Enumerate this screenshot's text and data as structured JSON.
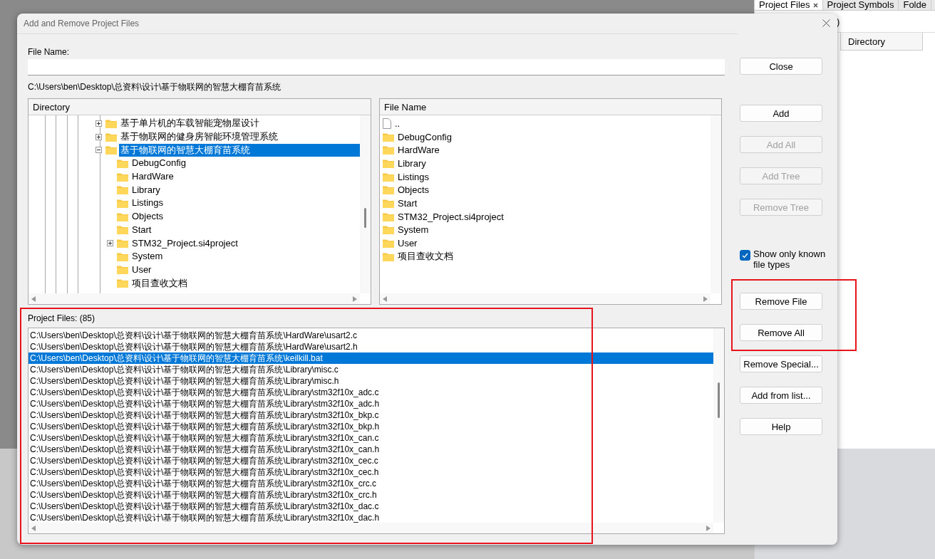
{
  "desktop": {
    "app_tabs": [
      {
        "label": "Project Files",
        "selected": true,
        "closable": true
      },
      {
        "label": "Project Symbols",
        "selected": false,
        "closable": false
      },
      {
        "label": "Folde",
        "selected": false,
        "closable": false
      }
    ],
    "app_filter_text": ")",
    "app_column": "Directory"
  },
  "dialog": {
    "title": "Add and Remove Project Files",
    "file_name_label": "File Name:",
    "current_path": "C:\\Users\\ben\\Desktop\\总资料\\设计\\基于物联网的智慧大棚育苗系统",
    "directory": {
      "header": "Directory",
      "items": [
        {
          "name": "基于单片机的车载智能宠物屋设计",
          "expanded": false,
          "selected": false
        },
        {
          "name": "基于物联网的健身房智能环境管理系统",
          "expanded": false,
          "selected": false
        },
        {
          "name": "基于物联网的智慧大棚育苗系统",
          "expanded": true,
          "selected": true,
          "children": [
            {
              "name": "DebugConfig",
              "selected": false
            },
            {
              "name": "HardWare",
              "selected": false
            },
            {
              "name": "Library",
              "selected": false
            },
            {
              "name": "Listings",
              "selected": false
            },
            {
              "name": "Objects",
              "selected": false
            },
            {
              "name": "Start",
              "selected": false
            },
            {
              "name": "STM32_Project.si4project",
              "expanded": false,
              "selected": false
            },
            {
              "name": "System",
              "selected": false
            },
            {
              "name": "User",
              "selected": false
            },
            {
              "name": "项目查收文档",
              "selected": false
            }
          ]
        }
      ]
    },
    "file_list": {
      "header": "File Name",
      "items": [
        {
          "name": "..",
          "kind": "parent"
        },
        {
          "name": "DebugConfig",
          "kind": "folder"
        },
        {
          "name": "HardWare",
          "kind": "folder"
        },
        {
          "name": "Library",
          "kind": "folder"
        },
        {
          "name": "Listings",
          "kind": "folder"
        },
        {
          "name": "Objects",
          "kind": "folder"
        },
        {
          "name": "Start",
          "kind": "folder"
        },
        {
          "name": "STM32_Project.si4project",
          "kind": "folder"
        },
        {
          "name": "System",
          "kind": "folder"
        },
        {
          "name": "User",
          "kind": "folder"
        },
        {
          "name": "项目查收文档",
          "kind": "folder"
        }
      ]
    },
    "buttons_top": [
      {
        "label": "Close",
        "disabled": false
      },
      {
        "label": "Add",
        "disabled": false
      },
      {
        "label": "Add All",
        "disabled": true
      },
      {
        "label": "Add Tree",
        "disabled": true
      },
      {
        "label": "Remove Tree",
        "disabled": true
      }
    ],
    "checkbox": {
      "label": "Show only known file types",
      "checked": true
    },
    "buttons_bottom": [
      {
        "label": "Remove File",
        "disabled": false
      },
      {
        "label": "Remove All",
        "disabled": false
      },
      {
        "label": "Remove Special...",
        "disabled": false
      },
      {
        "label": "Add from list...",
        "disabled": false
      },
      {
        "label": "Help",
        "disabled": false
      }
    ],
    "project_files": {
      "label": "Project Files: (85)",
      "rows": [
        {
          "path": "C:\\Users\\ben\\Desktop\\总资料\\设计\\基于物联网的智慧大棚育苗系统\\HardWare\\usart2.c",
          "selected": false
        },
        {
          "path": "C:\\Users\\ben\\Desktop\\总资料\\设计\\基于物联网的智慧大棚育苗系统\\HardWare\\usart2.h",
          "selected": false
        },
        {
          "path": "C:\\Users\\ben\\Desktop\\总资料\\设计\\基于物联网的智慧大棚育苗系统\\keilkill.bat",
          "selected": true
        },
        {
          "path": "C:\\Users\\ben\\Desktop\\总资料\\设计\\基于物联网的智慧大棚育苗系统\\Library\\misc.c",
          "selected": false
        },
        {
          "path": "C:\\Users\\ben\\Desktop\\总资料\\设计\\基于物联网的智慧大棚育苗系统\\Library\\misc.h",
          "selected": false
        },
        {
          "path": "C:\\Users\\ben\\Desktop\\总资料\\设计\\基于物联网的智慧大棚育苗系统\\Library\\stm32f10x_adc.c",
          "selected": false
        },
        {
          "path": "C:\\Users\\ben\\Desktop\\总资料\\设计\\基于物联网的智慧大棚育苗系统\\Library\\stm32f10x_adc.h",
          "selected": false
        },
        {
          "path": "C:\\Users\\ben\\Desktop\\总资料\\设计\\基于物联网的智慧大棚育苗系统\\Library\\stm32f10x_bkp.c",
          "selected": false
        },
        {
          "path": "C:\\Users\\ben\\Desktop\\总资料\\设计\\基于物联网的智慧大棚育苗系统\\Library\\stm32f10x_bkp.h",
          "selected": false
        },
        {
          "path": "C:\\Users\\ben\\Desktop\\总资料\\设计\\基于物联网的智慧大棚育苗系统\\Library\\stm32f10x_can.c",
          "selected": false
        },
        {
          "path": "C:\\Users\\ben\\Desktop\\总资料\\设计\\基于物联网的智慧大棚育苗系统\\Library\\stm32f10x_can.h",
          "selected": false
        },
        {
          "path": "C:\\Users\\ben\\Desktop\\总资料\\设计\\基于物联网的智慧大棚育苗系统\\Library\\stm32f10x_cec.c",
          "selected": false
        },
        {
          "path": "C:\\Users\\ben\\Desktop\\总资料\\设计\\基于物联网的智慧大棚育苗系统\\Library\\stm32f10x_cec.h",
          "selected": false
        },
        {
          "path": "C:\\Users\\ben\\Desktop\\总资料\\设计\\基于物联网的智慧大棚育苗系统\\Library\\stm32f10x_crc.c",
          "selected": false
        },
        {
          "path": "C:\\Users\\ben\\Desktop\\总资料\\设计\\基于物联网的智慧大棚育苗系统\\Library\\stm32f10x_crc.h",
          "selected": false
        },
        {
          "path": "C:\\Users\\ben\\Desktop\\总资料\\设计\\基于物联网的智慧大棚育苗系统\\Library\\stm32f10x_dac.c",
          "selected": false
        },
        {
          "path": "C:\\Users\\ben\\Desktop\\总资料\\设计\\基于物联网的智慧大棚育苗系统\\Library\\stm32f10x_dac.h",
          "selected": false
        }
      ]
    }
  }
}
